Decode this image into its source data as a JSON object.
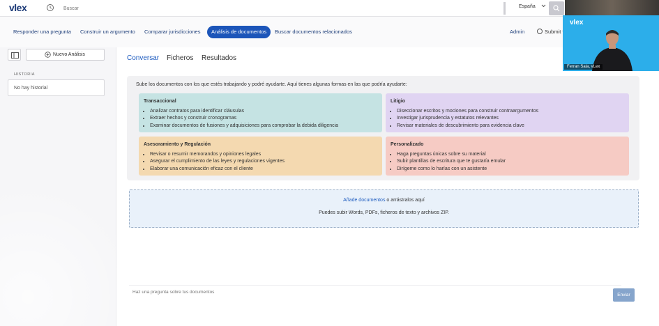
{
  "header": {
    "logo": "vlex",
    "search": {
      "placeholder": "Buscar"
    },
    "country": "España"
  },
  "nav": {
    "tabs": [
      {
        "label": "Responder una pregunta"
      },
      {
        "label": "Construir un argumento"
      },
      {
        "label": "Comparar jurisdicciones"
      },
      {
        "label": "Análisis de documentos",
        "active": true
      },
      {
        "label": "Buscar documentos relacionados"
      }
    ],
    "admin": "Admin",
    "submit": "Submit f"
  },
  "sidebar": {
    "new_analysis": "Nuevo Análisis",
    "history_heading": "HISTORIA",
    "history_empty": "No hay historial"
  },
  "main": {
    "tabs": [
      {
        "label": "Conversar",
        "active": true
      },
      {
        "label": "Ficheros"
      },
      {
        "label": "Resultados"
      }
    ],
    "intro": "Sube los documentos con los que estés trabajando y podré ayudarte. Aquí tienes algunas formas en las que podría ayudarte:",
    "cards": [
      {
        "title": "Transaccional",
        "color": "#c5e3e3",
        "items": [
          "Analizar contratos para identificar cláusulas",
          "Extraer hechos y construir cronogramas",
          "Examinar documentos de fusiones y adquisiciones para comprobar la debida diligencia"
        ]
      },
      {
        "title": "Litigio",
        "color": "#e0d4f2",
        "items": [
          "Diseccionar escritos y mociones para construir contraargumentos",
          "Investigar jurisprudencia y estatutos relevantes",
          "Revisar materiales de descubrimiento para evidencia clave"
        ]
      },
      {
        "title": "Asesoramiento y Regulación",
        "color": "#f4d9b0",
        "items": [
          "Revisar o resumir memorandos y opiniones legales",
          "Asegurar el cumplimiento de las leyes y regulaciones vigentes",
          "Elaborar una comunicación eficaz con el cliente"
        ]
      },
      {
        "title": "Personalizado",
        "color": "#f6cbc4",
        "items": [
          "Haga preguntas únicas sobre su material",
          "Subir plantillas de escritura que te gustaría emular",
          "Dirígeme como lo harías con un asistente"
        ]
      }
    ],
    "upload": {
      "link": "Añade documentos",
      "text": " o arrástralos aquí",
      "hint": "Puedes subir Words, PDFs, ficheros de texto y archivos ZIP."
    },
    "question": {
      "placeholder": "Haz una pregunta sobre tus documentos"
    },
    "send": "Enviar"
  },
  "video": {
    "logo": "vlex",
    "caption": "Ferran Sala, vLex"
  },
  "colors": {
    "primary": "#1c55b9",
    "nav_text": "#1f3f7a",
    "upload_bg": "#e9f1fa",
    "send_btn": "#86a5cc",
    "video_bg": "#2caeea"
  }
}
